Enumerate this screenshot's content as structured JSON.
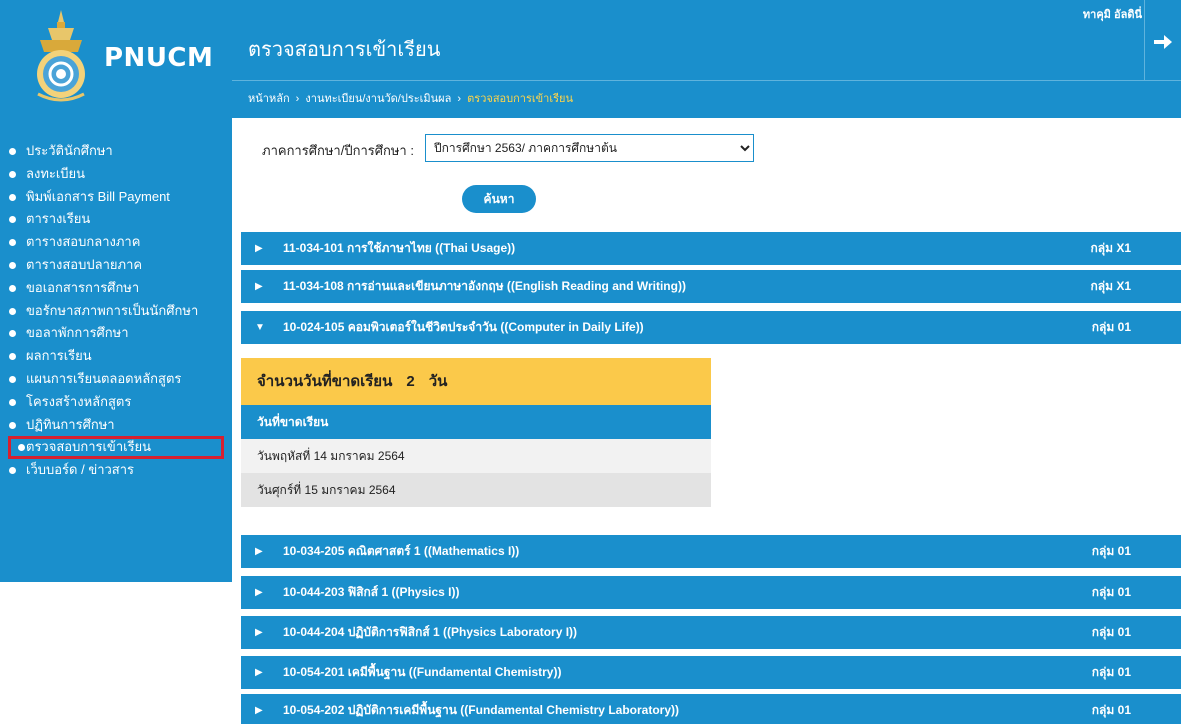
{
  "brand": {
    "name": "PNUCM"
  },
  "header": {
    "title": "ตรวจสอบการเข้าเรียน",
    "user_name": "ทาคุมิ อัลดินี่",
    "logout_icon": "arrow-right-icon"
  },
  "breadcrumb": {
    "items": [
      "หน้าหลัก",
      "งานทะเบียน/งานวัด/ประเมินผล"
    ],
    "separator": "›",
    "current": "ตรวจสอบการเข้าเรียน"
  },
  "sidebar": {
    "items": [
      {
        "label": "ประวัตินักศึกษา"
      },
      {
        "label": "ลงทะเบียน"
      },
      {
        "label": "พิมพ์เอกสาร Bill Payment"
      },
      {
        "label": "ตารางเรียน"
      },
      {
        "label": "ตารางสอบกลางภาค"
      },
      {
        "label": "ตารางสอบปลายภาค"
      },
      {
        "label": "ขอเอกสารการศึกษา"
      },
      {
        "label": "ขอรักษาสภาพการเป็นนักศึกษา"
      },
      {
        "label": "ขอลาพักการศึกษา"
      },
      {
        "label": "ผลการเรียน"
      },
      {
        "label": "แผนการเรียนตลอดหลักสูตร"
      },
      {
        "label": "โครงสร้างหลักสูตร"
      },
      {
        "label": "ปฏิทินการศึกษา"
      },
      {
        "label": "ตรวจสอบการเข้าเรียน"
      },
      {
        "label": "เว็บบอร์ด / ข่าวสาร"
      }
    ],
    "active_index": 13
  },
  "filter": {
    "label": "ภาคการศึกษา/ปีการศึกษา :",
    "selected": "ปีการศึกษา 2563/ ภาคการศึกษาต้น",
    "search_label": "ค้นหา"
  },
  "courses": [
    {
      "title": "11-034-101 การใช้ภาษาไทย ((Thai Usage))",
      "group": "กลุ่ม X1",
      "expanded": false
    },
    {
      "title": "11-034-108 การอ่านและเขียนภาษาอังกฤษ ((English Reading and Writing))",
      "group": "กลุ่ม X1",
      "expanded": false
    },
    {
      "title": "10-024-105 คอมพิวเตอร์ในชีวิตประจำวัน ((Computer in Daily Life))",
      "group": "กลุ่ม 01",
      "expanded": true
    },
    {
      "title": "10-034-205 คณิตศาสตร์ 1 ((Mathematics I))",
      "group": "กลุ่ม 01",
      "expanded": false
    },
    {
      "title": "10-044-203 ฟิสิกส์ 1 ((Physics I))",
      "group": "กลุ่ม 01",
      "expanded": false
    },
    {
      "title": "10-044-204 ปฏิบัติการฟิสิกส์ 1 ((Physics Laboratory I))",
      "group": "กลุ่ม 01",
      "expanded": false
    },
    {
      "title": "10-054-201 เคมีพื้นฐาน ((Fundamental Chemistry))",
      "group": "กลุ่ม 01",
      "expanded": false
    },
    {
      "title": "10-054-202 ปฏิบัติการเคมีพื้นฐาน ((Fundamental Chemistry Laboratory))",
      "group": "กลุ่ม 01",
      "expanded": false
    }
  ],
  "absence": {
    "summary_prefix": "จำนวนวันที่ขาดเรียน",
    "count": "2",
    "summary_suffix": "วัน",
    "column_header": "วันที่ขาดเรียน",
    "dates": [
      "วันพฤหัสที่ 14 มกราคม 2564",
      "วันศุกร์ที่ 15 มกราคม 2564"
    ]
  },
  "colors": {
    "primary": "#1a8fcc",
    "highlight": "#fbc94a",
    "active_outline": "#d6202f",
    "crumb_current": "#ffd54a"
  }
}
